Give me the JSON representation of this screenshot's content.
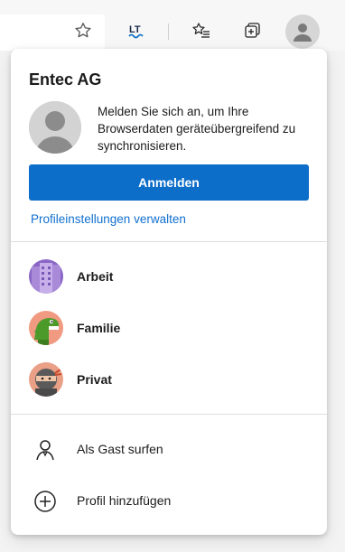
{
  "toolbar": {
    "favorite_icon": "star-outline-icon",
    "extension_icon": "languagetool-icon",
    "favorites_icon": "favorites-list-icon",
    "collections_icon": "collections-icon",
    "profile_icon": "profile-avatar-icon",
    "accent": "#1a75c8"
  },
  "popup": {
    "organization": "Entec AG",
    "signin_message": "Melden Sie sich an, um Ihre Browserdaten geräteübergreifend zu synchronisieren.",
    "signin_button": "Anmelden",
    "manage_link": "Profileinstellungen verwalten",
    "profiles": [
      {
        "label": "Arbeit",
        "icon": "office-building-avatar",
        "color": "#8a67c7"
      },
      {
        "label": "Familie",
        "icon": "dinosaur-avatar",
        "color": "#f19a82"
      },
      {
        "label": "Privat",
        "icon": "ninja-avatar",
        "color": "#e9a087"
      }
    ],
    "actions": [
      {
        "label": "Als Gast surfen",
        "icon": "guest-person-icon"
      },
      {
        "label": "Profil hinzufügen",
        "icon": "add-circle-icon"
      }
    ]
  },
  "colors": {
    "primary_button": "#0d6ec9",
    "link": "#1170cf"
  }
}
